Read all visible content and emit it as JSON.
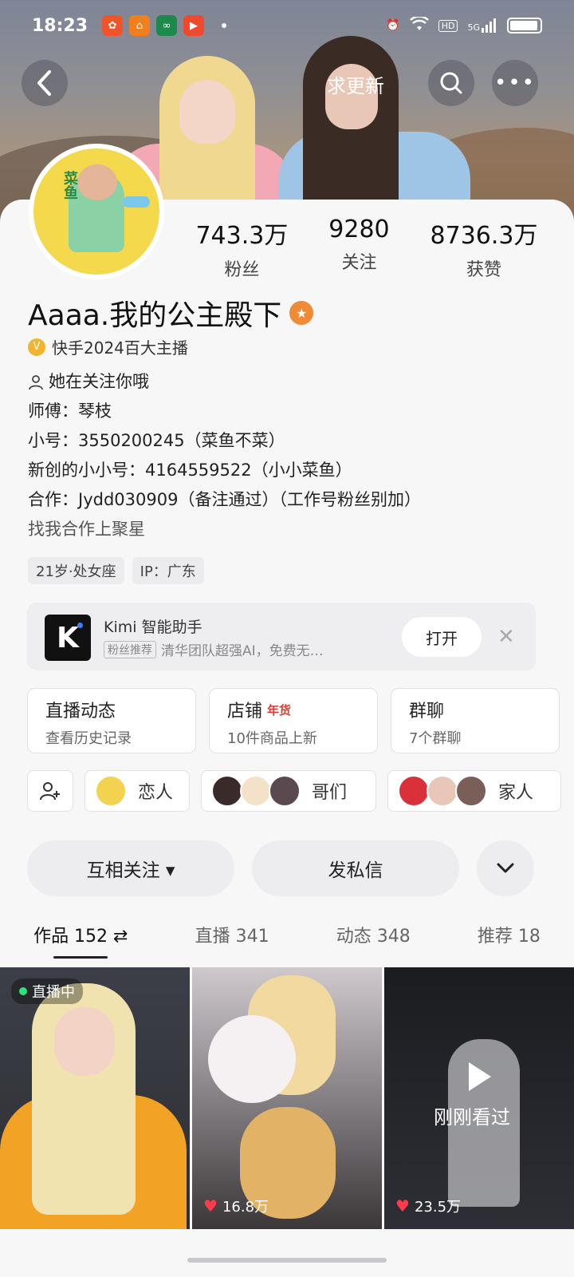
{
  "status_bar": {
    "time": "18:23",
    "apps": [
      {
        "icon": "app-icon-1",
        "color": "#f0552a",
        "glyph": "✿"
      },
      {
        "icon": "app-icon-2",
        "color": "#f27f1e",
        "glyph": "⌂"
      },
      {
        "icon": "app-icon-3",
        "color": "#1c8a4a",
        "glyph": "∞"
      },
      {
        "icon": "app-icon-4",
        "color": "#f04a2e",
        "glyph": "▶"
      }
    ],
    "network": "5G",
    "hd": "HD"
  },
  "header": {
    "title": "求更新"
  },
  "stats": [
    {
      "value": "743.3万",
      "label": "粉丝"
    },
    {
      "value": "9280",
      "label": "关注"
    },
    {
      "value": "8736.3万",
      "label": "获赞"
    }
  ],
  "profile": {
    "name": "Aaaa.我的公主殿下",
    "verify_text": "快手2024百大主播",
    "avatar_text": "菜鱼"
  },
  "bio": {
    "line1": "她在关注你哦",
    "line2": "师傅：琴枝",
    "line3": "小号：3550200245（菜鱼不菜）",
    "line4": "新创的小小号：4164559522（小小菜鱼）",
    "line5": "合作：Jydd030909（备注通过）（工作号粉丝别加）",
    "line6": "找我合作上聚星"
  },
  "tags": [
    "21岁·处女座",
    "IP：广东"
  ],
  "ad": {
    "logo": "K",
    "title": "Kimi 智能助手",
    "pill": "粉丝推荐",
    "subtitle": "清华团队超强AI，免费无…",
    "open_label": "打开"
  },
  "boxes": [
    {
      "title": "直播动态",
      "tag": "",
      "sub": "查看历史记录"
    },
    {
      "title": "店铺",
      "tag": "年货",
      "sub": "10件商品上新"
    },
    {
      "title": "群聊",
      "tag": "",
      "sub": "7个群聊"
    }
  ],
  "groups": [
    {
      "label": "恋人",
      "avatars": [
        "#f2d24e"
      ]
    },
    {
      "label": "哥们",
      "avatars": [
        "#3a2a2a",
        "#f3e1c8",
        "#5a4a50"
      ]
    },
    {
      "label": "家人",
      "avatars": [
        "#d9303a",
        "#e8c6b8",
        "#7a5f58"
      ]
    }
  ],
  "actions": {
    "follow": "互相关注 ▾",
    "message": "发私信"
  },
  "tabs": [
    "作品 152 ⇄",
    "直播 341",
    "动态 348",
    "推荐 18"
  ],
  "grid": {
    "tile1": {
      "live": "直播中"
    },
    "tile2": {
      "likes": "16.8万"
    },
    "tile3": {
      "seen": "刚刚看过",
      "likes": "23.5万"
    }
  }
}
